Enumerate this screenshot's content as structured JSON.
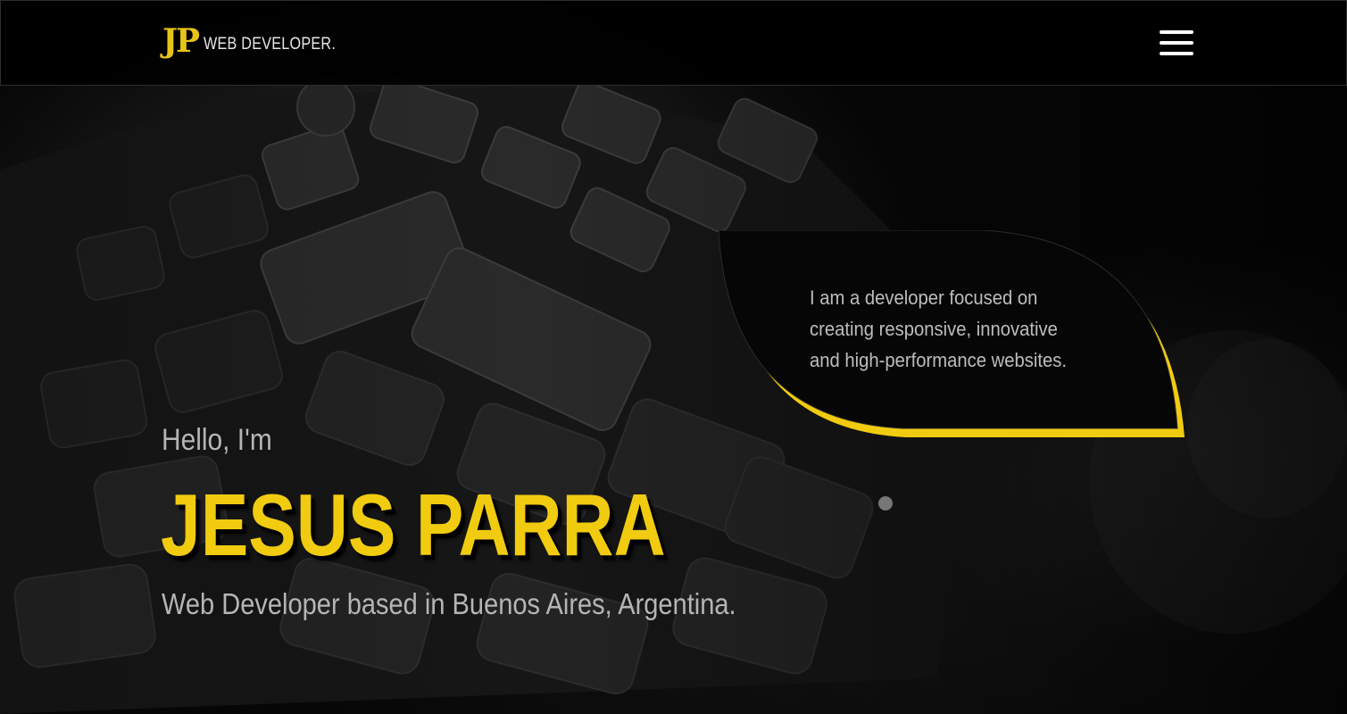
{
  "header": {
    "logo_mark": "JP",
    "logo_text": "WEB DEVELOPER.",
    "menu_icon": "hamburger-menu-icon"
  },
  "bubble": {
    "line1": "I am a developer focused on",
    "line2": "creating responsive, innovative",
    "line3": "and high-performance websites."
  },
  "hero": {
    "greeting": "Hello, I'm",
    "name": "JESUS PARRA",
    "tagline": "Web Developer based in Buenos Aires, Argentina."
  },
  "colors": {
    "accent": "#f0cb10",
    "background": "#050505",
    "text_muted": "#b5b5b5"
  }
}
